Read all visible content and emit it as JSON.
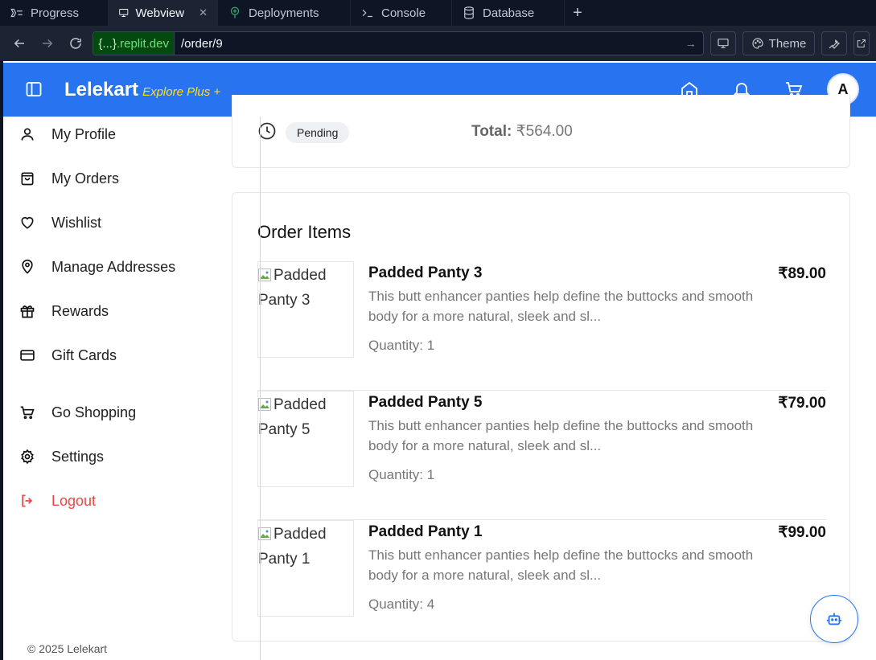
{
  "ide": {
    "tabs": [
      {
        "label": "Progress",
        "icon": "progress-icon",
        "active": false
      },
      {
        "label": "Webview",
        "icon": "monitor-icon",
        "active": true
      },
      {
        "label": "Deployments",
        "icon": "deploy-icon",
        "active": false
      },
      {
        "label": "Console",
        "icon": "terminal-icon",
        "active": false
      },
      {
        "label": "Database",
        "icon": "database-icon",
        "active": false
      }
    ],
    "close_glyph": "✕",
    "add_glyph": "+"
  },
  "urlbar": {
    "domain_prefix": "{...}",
    "domain_suffix": ".replit.dev",
    "path": "/order/9",
    "theme_label": "Theme"
  },
  "header": {
    "brand": "Lelekart",
    "tagline": "Explore Plus +",
    "avatar_initial": "A"
  },
  "sidebar": {
    "items": [
      {
        "label": "My Profile",
        "icon": "user-icon"
      },
      {
        "label": "My Orders",
        "icon": "shopping-bag-icon"
      },
      {
        "label": "Wishlist",
        "icon": "heart-icon"
      },
      {
        "label": "Manage Addresses",
        "icon": "map-pin-icon"
      },
      {
        "label": "Rewards",
        "icon": "gift-icon"
      },
      {
        "label": "Gift Cards",
        "icon": "credit-card-icon"
      },
      {
        "label": "Go Shopping",
        "icon": "cart-icon"
      },
      {
        "label": "Settings",
        "icon": "gear-icon"
      },
      {
        "label": "Logout",
        "icon": "logout-icon"
      }
    ],
    "copyright": "© 2025 Lelekart"
  },
  "order": {
    "status": "Pending",
    "total_label": "Total:",
    "total_value": "₹564.00",
    "items_title": "Order Items",
    "items": [
      {
        "img_alt": "Padded Panty 3",
        "name": "Padded Panty 3",
        "desc": "This butt enhancer panties help define the buttocks and smooth body for a more natural, sleek and sl...",
        "qty": "Quantity: 1",
        "price": "₹89.00"
      },
      {
        "img_alt": "Padded Panty 5",
        "name": "Padded Panty 5",
        "desc": "This butt enhancer panties help define the buttocks and smooth body for a more natural, sleek and sl...",
        "qty": "Quantity: 1",
        "price": "₹79.00"
      },
      {
        "img_alt": "Padded Panty 1",
        "name": "Padded Panty 1",
        "desc": "This butt enhancer panties help define the buttocks and smooth body for a more natural, sleek and sl...",
        "qty": "Quantity: 4",
        "price": "₹99.00"
      }
    ]
  },
  "colors": {
    "ide_bg": "#0e1525",
    "brand_blue": "#2874f0",
    "tagline_yellow": "#ffe11b",
    "logout_red": "#ef4444"
  }
}
